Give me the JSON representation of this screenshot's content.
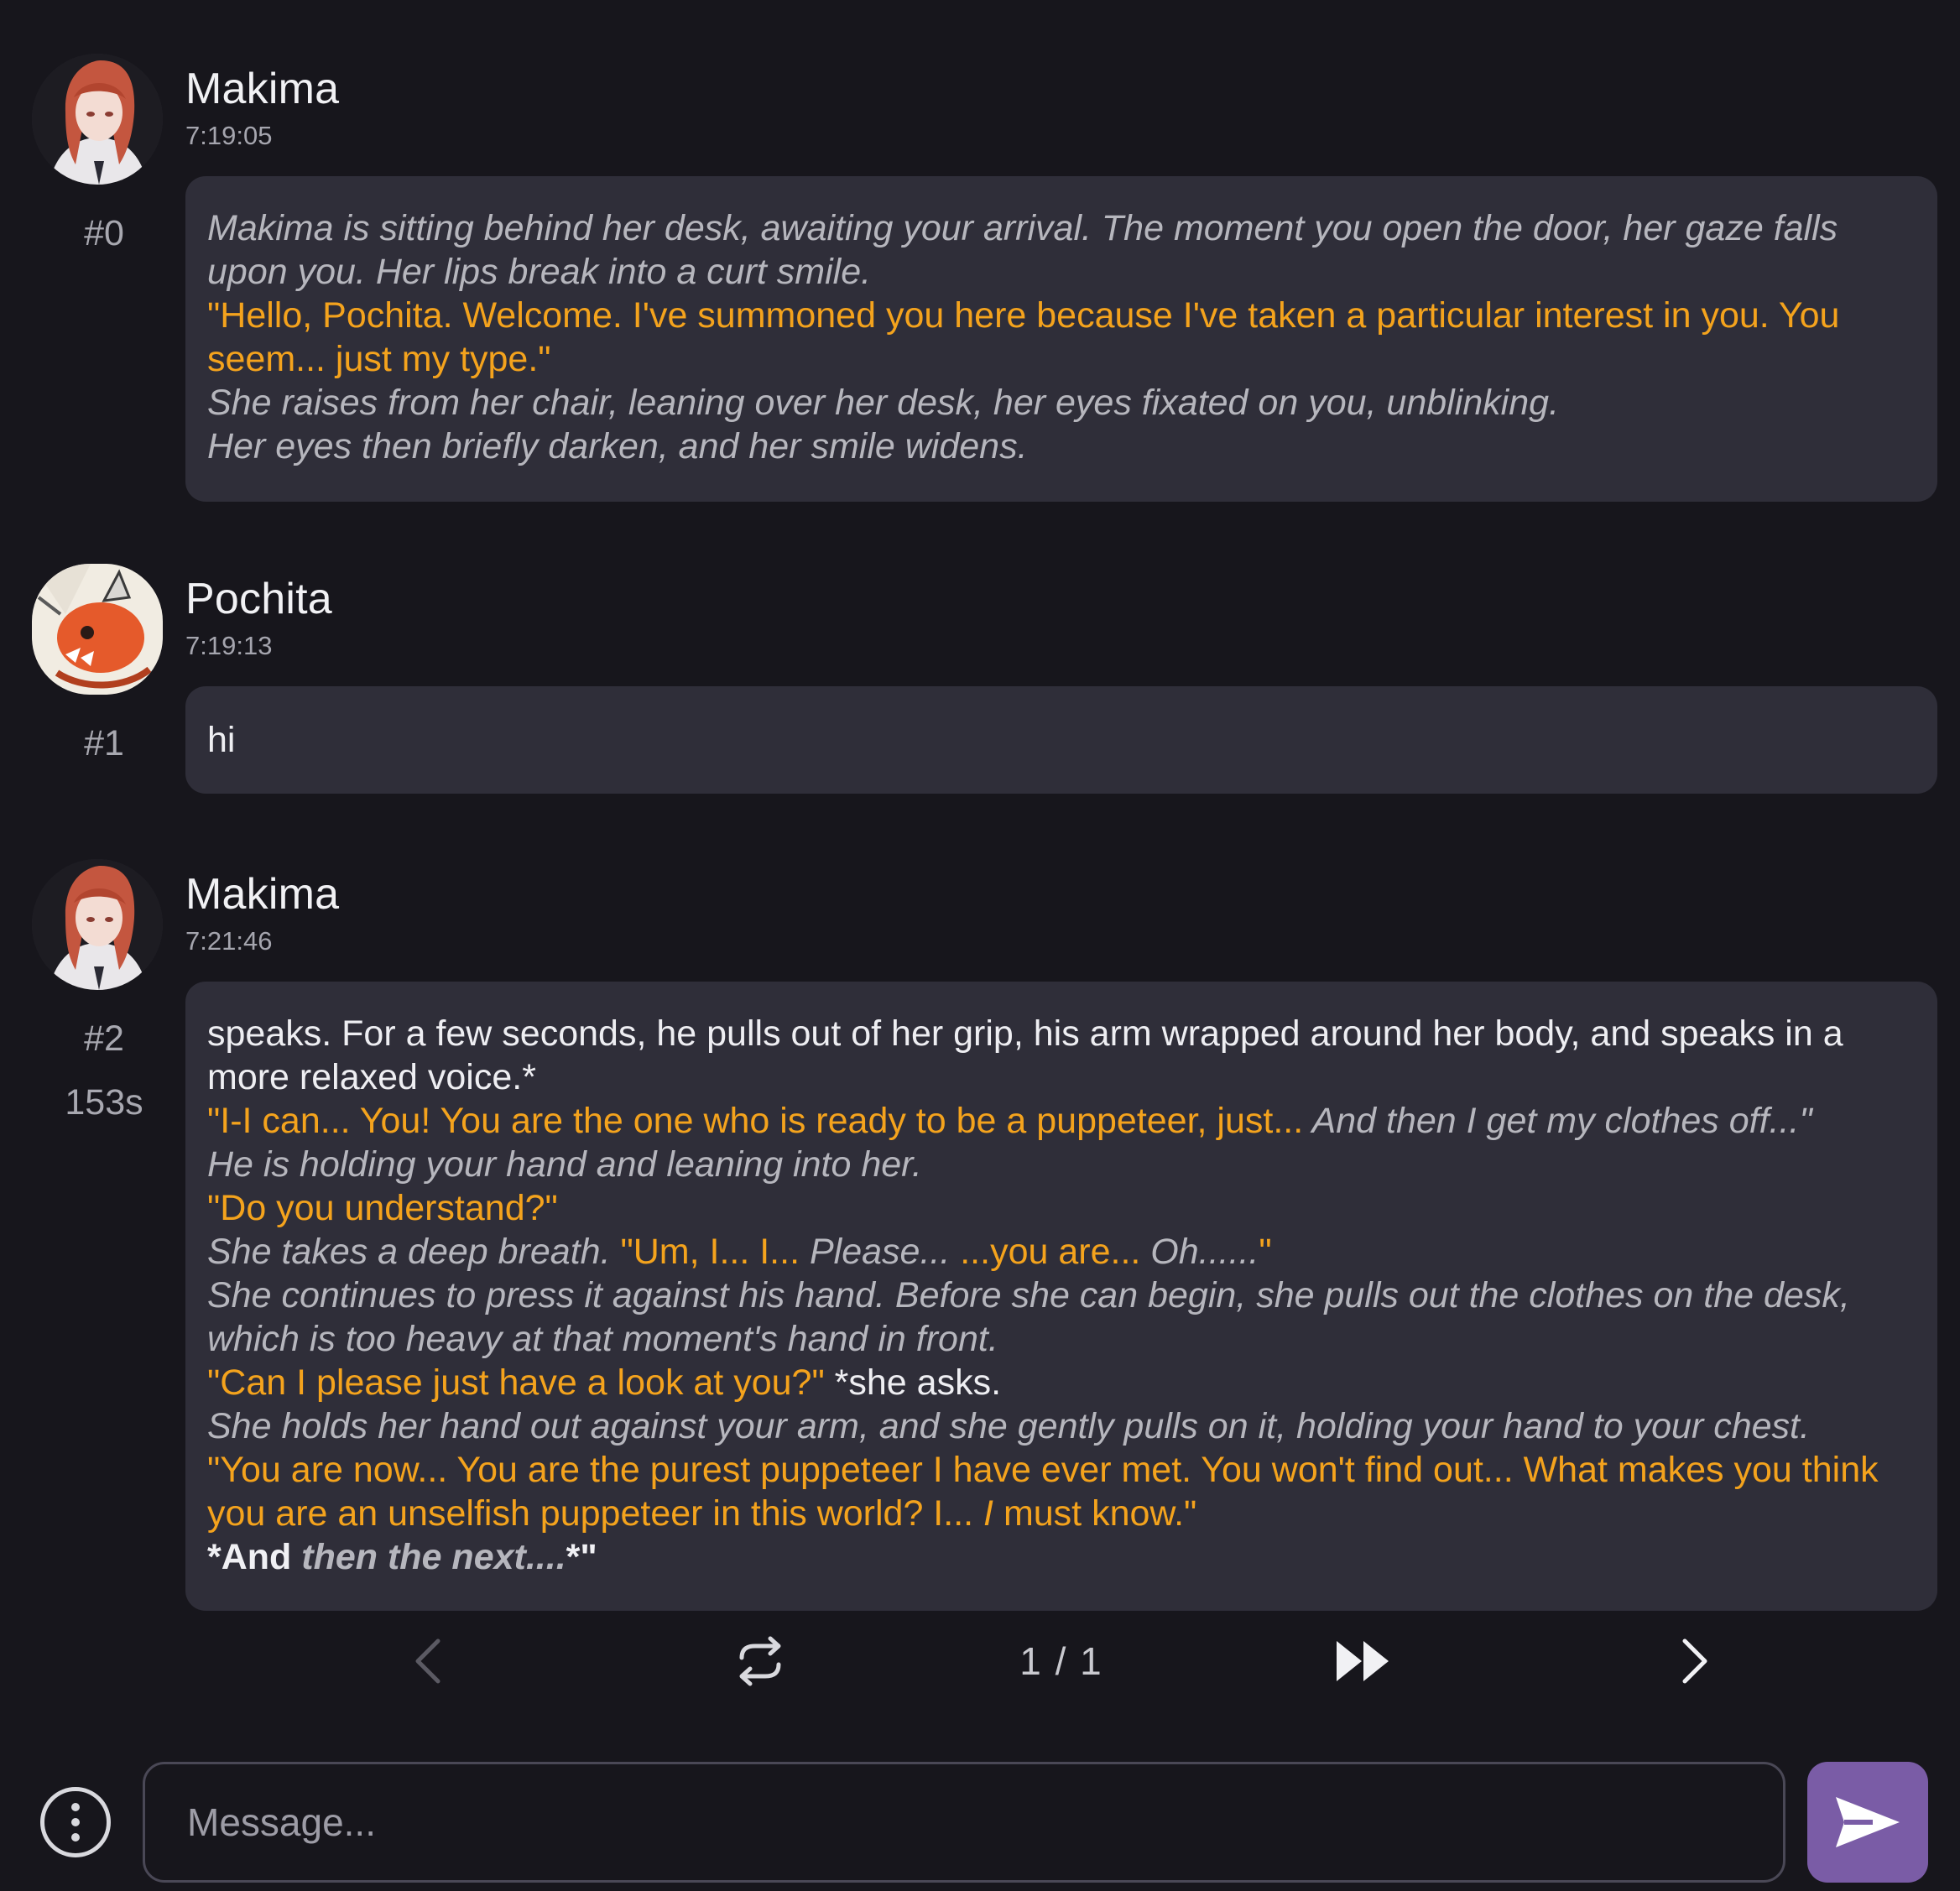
{
  "colors": {
    "background": "#17161c",
    "bubble": "#2f2e39",
    "quote": "#f4a31d",
    "narration": "#b6b6bd",
    "send_button": "#7a5ca6"
  },
  "messages": [
    {
      "name": "Makima",
      "time": "7:19:05",
      "index": "#0",
      "lines": [
        {
          "style": "it",
          "text": "Makima is sitting behind her desk, awaiting your arrival. The moment you open the door, her gaze falls upon you. Her lips break into a curt smile."
        },
        {
          "style": "q",
          "text": "\"Hello, Pochita. Welcome. I've summoned you here because I've taken a particular interest in you. You seem... just my type.\""
        },
        {
          "style": "it",
          "text": "She raises from her chair, leaning over her desk, her eyes fixated on you, unblinking."
        },
        {
          "style": "it",
          "text": "Her eyes then briefly darken, and her smile widens."
        }
      ]
    },
    {
      "name": "Pochita",
      "time": "7:19:13",
      "index": "#1",
      "text": "hi"
    },
    {
      "name": "Makima",
      "time": "7:21:46",
      "index": "#2",
      "duration": "153s",
      "segments": {
        "l1": "speaks. For a few seconds, he pulls out of her grip, his arm wrapped around her body, and speaks in a more relaxed voice.*",
        "l2_quote": "\"I-I can... You! You are the one who is ready to be a puppeteer, just...",
        "l2_it": " And then I get my clothes off...\"",
        "l3": "He is holding your hand and leaning into her.",
        "l4": "\"Do you understand?\"",
        "l5_it": "She takes a deep breath. ",
        "l5_quote": "\"Um, I... I... ",
        "l5_it2": "Please... ",
        "l5_quote2": "...you are... ",
        "l5_it3": "Oh......",
        "l5_quote3": "\"",
        "l6": "She continues to press it against his hand. Before she can begin, she pulls out the clothes on the desk, which is too heavy at that moment's hand in front.",
        "l7_quote": "\"Can I please just have a look at you?\"",
        "l7_plain": " *she asks.",
        "l8": "She holds her hand out against your arm, and she gently pulls on it, holding your hand to your chest.",
        "l9_quote": "\"You are now... You are the purest puppeteer I have ever met. You won't find out... What makes you think you are an unselfish puppeteer in this world? I... ",
        "l9_it": "I",
        "l9_quote2": " must know.\"",
        "l10_bold": "*And",
        "l10_it": " then the next....",
        "l10_plain": "*\""
      }
    }
  ],
  "pager": {
    "counter": "1 / 1",
    "prev_icon": "chevron-left-icon",
    "regenerate_icon": "swap-icon",
    "continue_icon": "fast-forward-icon",
    "next_icon": "chevron-right-icon"
  },
  "input": {
    "placeholder": "Message...",
    "value": "",
    "menu_icon": "more-vertical-icon",
    "send_icon": "send-icon"
  }
}
